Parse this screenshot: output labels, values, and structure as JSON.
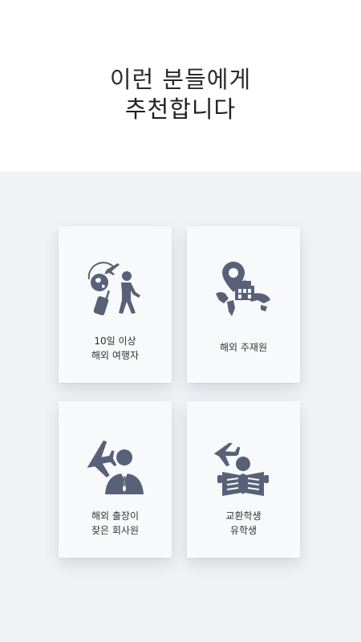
{
  "header": {
    "line1": "이런 분들에게",
    "line2": "추천합니다"
  },
  "cards": [
    {
      "icon": "traveler-icon",
      "lines": [
        "10일 이상",
        "해외 여행자"
      ]
    },
    {
      "icon": "map-pin-world-icon",
      "lines": [
        "해외 주재원"
      ]
    },
    {
      "icon": "airplane-businessman-icon",
      "lines": [
        "해외 출장이",
        "잦은 회사원"
      ]
    },
    {
      "icon": "student-reading-icon",
      "lines": [
        "교환학생",
        "유학생"
      ]
    }
  ],
  "colors": {
    "icon": "#586178",
    "background_gray": "#f1f2f5",
    "card": "#f8f9fa"
  }
}
